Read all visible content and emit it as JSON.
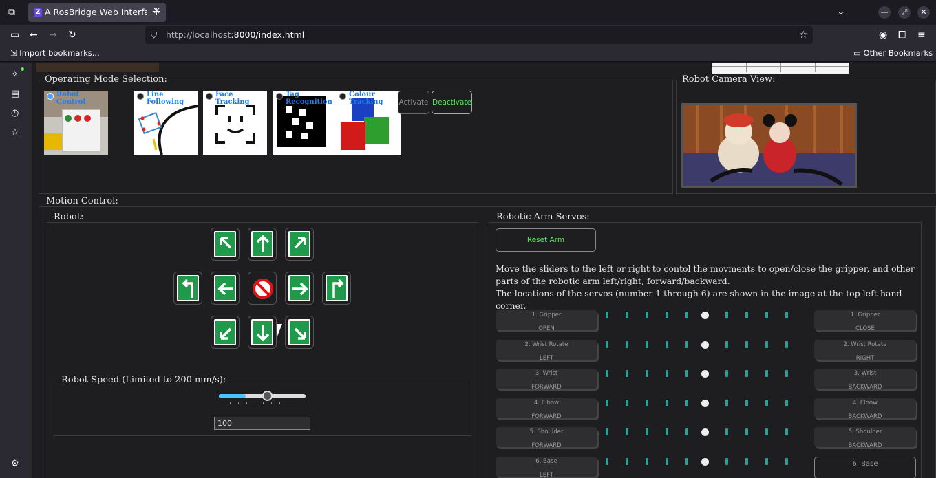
{
  "browser": {
    "tab_title": "A RosBridge Web Interfa",
    "url_host": "http://localhost",
    "url_path": ":8000/index.html",
    "bookmarks": {
      "import": "Import bookmarks...",
      "other": "Other Bookmarks"
    }
  },
  "operating_mode": {
    "legend": "Operating Mode Selection:",
    "modes": [
      {
        "label": "Robot Control",
        "selected": true
      },
      {
        "label": "Line Following",
        "selected": false
      },
      {
        "label": "Face Tracking",
        "selected": false
      },
      {
        "label": "Tag Recognition",
        "selected": false
      },
      {
        "label": "Colour Tracking",
        "selected": false
      }
    ],
    "activate_label": "Activate",
    "deactivate_label": "Deactivate"
  },
  "camera": {
    "legend": "Robot Camera View:"
  },
  "top_diagram_labels": [
    "",
    "",
    ""
  ],
  "motion": {
    "legend": "Motion Control:",
    "robot_legend": "Robot:",
    "speed_legend": "Robot Speed (Limited to 200 mm/s):",
    "speed_value": "100",
    "speed_fraction": 0.31
  },
  "arm": {
    "legend": "Robotic Arm Servos:",
    "reset_label": "Reset Arm",
    "instructions_1": "Move the sliders to the left or right to contol the movments to open/close the gripper, and other parts of the robotic arm left/right, forward/backward.",
    "instructions_2": "The locations of the servos (number 1 through 6) are shown in the image at the top left-hand corner.",
    "servos": [
      {
        "name": "1. Gripper",
        "left": "OPEN",
        "right": "CLOSE"
      },
      {
        "name": "2. Wrist Rotate",
        "left": "LEFT",
        "right": "RIGHT"
      },
      {
        "name": "3. Wrist",
        "left": "FORWARD",
        "right": "BACKWARD"
      },
      {
        "name": "4. Elbow",
        "left": "FORWARD",
        "right": "BACKWARD"
      },
      {
        "name": "5. Shoulder",
        "left": "FORWARD",
        "right": "BACKWARD"
      },
      {
        "name": "6. Base",
        "left": "LEFT",
        "right": "6. Base"
      }
    ]
  },
  "colors": {
    "accent_green": "#1e9a4a",
    "tick_teal": "#2aa198",
    "text_green": "#5fe35f"
  }
}
